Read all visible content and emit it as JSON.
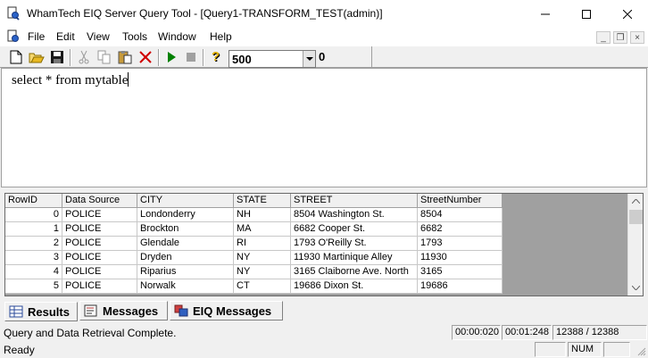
{
  "window": {
    "title": "WhamTech EIQ Server Query Tool - [Query1-TRANSFORM_TEST(admin)]"
  },
  "menu": {
    "items": [
      "File",
      "Edit",
      "View",
      "Tools",
      "Window",
      "Help"
    ]
  },
  "toolbar": {
    "max_rows": "500",
    "row_count": "0"
  },
  "editor": {
    "query_text": "select * from mytable"
  },
  "grid": {
    "columns": [
      "RowID",
      "Data Source",
      "CITY",
      "STATE",
      "STREET",
      "StreetNumber"
    ],
    "rows": [
      [
        "0",
        "POLICE",
        "Londonderry",
        "NH",
        "8504 Washington St.",
        "8504"
      ],
      [
        "1",
        "POLICE",
        "Brockton",
        "MA",
        "6682 Cooper St.",
        "6682"
      ],
      [
        "2",
        "POLICE",
        "Glendale",
        "RI",
        "1793 O'Reilly St.",
        "1793"
      ],
      [
        "3",
        "POLICE",
        "Dryden",
        "NY",
        "11930 Martinique Alley",
        "11930"
      ],
      [
        "4",
        "POLICE",
        "Riparius",
        "NY",
        "3165 Claiborne Ave. North",
        "3165"
      ],
      [
        "5",
        "POLICE",
        "Norwalk",
        "CT",
        "19686 Dixon St.",
        "19686"
      ]
    ]
  },
  "tabs": [
    {
      "label": "Results",
      "icon": "grid-icon"
    },
    {
      "label": "Messages",
      "icon": "messages-icon"
    },
    {
      "label": "EIQ Messages",
      "icon": "eiq-messages-icon"
    }
  ],
  "status": {
    "message": "Query and Data Retrieval Complete.",
    "elapsed_query": "00:00:020",
    "elapsed_total": "00:01:248",
    "records": "12388 / 12388",
    "ready": "Ready",
    "num": "NUM"
  },
  "colors": {
    "grid_bg": "#a0a0a0",
    "play_green": "#008000",
    "delete_red": "#d00000"
  }
}
